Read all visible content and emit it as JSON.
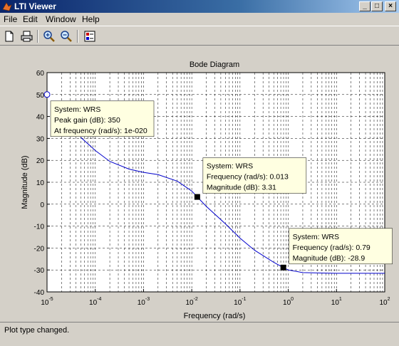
{
  "window": {
    "title": "LTI Viewer",
    "minimize_glyph": "_",
    "maximize_glyph": "□",
    "close_glyph": "×"
  },
  "menu": {
    "items": [
      "File",
      "Edit",
      "Window",
      "Help"
    ]
  },
  "toolbar": {
    "icons": [
      "new-document-icon",
      "print-icon",
      "zoom-in-icon",
      "zoom-out-icon",
      "plot-configurations-icon"
    ]
  },
  "status": {
    "text": "Plot type changed."
  },
  "colors": {
    "title_active": "#0a246a",
    "plot_line": "#0000cc",
    "datatip_bg": "#ffffe1"
  },
  "chart_data": {
    "type": "line",
    "title": "Bode Diagram",
    "xlabel": "Frequency  (rad/s)",
    "ylabel": "Magnitude (dB)",
    "xscale": "log",
    "xlim": [
      1e-05,
      100
    ],
    "ylim": [
      -40,
      60
    ],
    "x_ticks": [
      "-5",
      "-4",
      "-3",
      "-2",
      "-1",
      "0",
      "1",
      "2"
    ],
    "y_ticks": [
      60,
      50,
      40,
      30,
      20,
      10,
      0,
      -10,
      -20,
      -30,
      -40
    ],
    "grid": true,
    "series": [
      {
        "name": "WRS",
        "x": [
          5e-05,
          0.0001,
          0.0002,
          0.0005,
          0.001,
          0.002,
          0.005,
          0.01,
          0.013,
          0.02,
          0.05,
          0.1,
          0.2,
          0.5,
          0.79,
          1,
          2,
          5,
          10,
          100
        ],
        "values": [
          30.5,
          24.5,
          19.5,
          16,
          14.5,
          13.5,
          10.5,
          6,
          3.31,
          -1,
          -9,
          -15.5,
          -21,
          -26.5,
          -28.9,
          -30,
          -31.2,
          -31.4,
          -31.5,
          -31.5
        ]
      }
    ],
    "datatips": [
      {
        "lines": [
          "System: WRS",
          "Peak gain (dB): 350",
          "At frequency (rad/s): 1e-020"
        ],
        "x": 1e-05,
        "y": 50,
        "marker": "circle"
      },
      {
        "lines": [
          "System: WRS",
          "Frequency (rad/s): 0.013",
          "Magnitude (dB): 3.31"
        ],
        "x": 0.013,
        "y": 3.31,
        "marker": "square"
      },
      {
        "lines": [
          "System: WRS",
          "Frequency (rad/s): 0.79",
          "Magnitude (dB): -28.9"
        ],
        "x": 0.79,
        "y": -28.9,
        "marker": "square"
      }
    ]
  }
}
